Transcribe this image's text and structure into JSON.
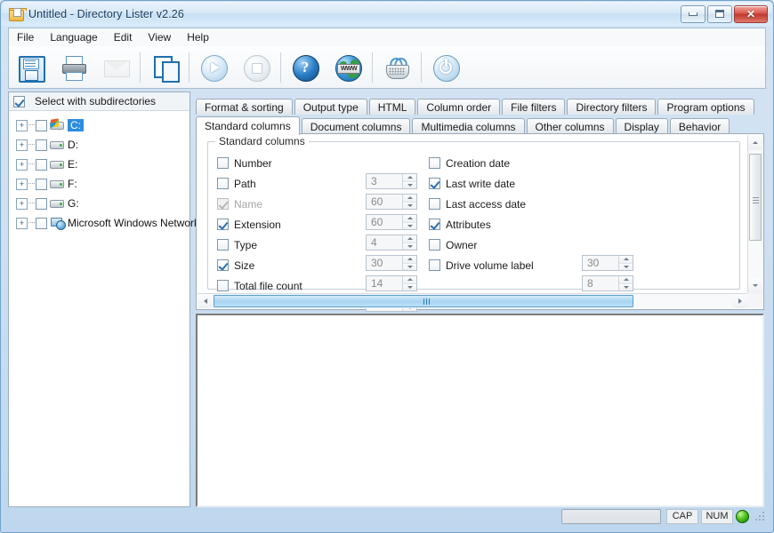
{
  "window": {
    "title": "Untitled - Directory Lister v2.26",
    "app_icon": "folder-document-icon",
    "controls": {
      "minimize": "minimize",
      "maximize": "maximize",
      "close": "close"
    }
  },
  "menubar": {
    "items": [
      {
        "label": "File"
      },
      {
        "label": "Language"
      },
      {
        "label": "Edit"
      },
      {
        "label": "View"
      },
      {
        "label": "Help"
      }
    ]
  },
  "toolbar": {
    "buttons": [
      {
        "name": "save-icon",
        "tooltip": "Save"
      },
      {
        "name": "print-icon",
        "tooltip": "Print"
      },
      {
        "name": "mail-icon",
        "tooltip": "Send by mail",
        "disabled": true
      },
      {
        "name": "copy-icon",
        "tooltip": "Copy"
      },
      {
        "name": "start-icon",
        "tooltip": "Start"
      },
      {
        "name": "stop-icon",
        "tooltip": "Stop",
        "disabled": true
      },
      {
        "name": "help-icon",
        "tooltip": "Help"
      },
      {
        "name": "www-icon",
        "tooltip": "Web site",
        "band_text": "WWW"
      },
      {
        "name": "basket-icon",
        "tooltip": "Buy"
      },
      {
        "name": "power-icon",
        "tooltip": "Exit"
      }
    ]
  },
  "tree": {
    "header_label": "Select with subdirectories",
    "header_checked": true,
    "items": [
      {
        "label": "C:",
        "icon": "windows-drive-icon",
        "selected": true,
        "checked": false,
        "expandable": true
      },
      {
        "label": "D:",
        "icon": "drive-icon",
        "selected": false,
        "checked": false,
        "expandable": true
      },
      {
        "label": "E:",
        "icon": "drive-icon",
        "selected": false,
        "checked": false,
        "expandable": true
      },
      {
        "label": "F:",
        "icon": "drive-icon",
        "selected": false,
        "checked": false,
        "expandable": true
      },
      {
        "label": "G:",
        "icon": "drive-icon",
        "selected": false,
        "checked": false,
        "expandable": true
      },
      {
        "label": "Microsoft Windows Network",
        "icon": "network-icon",
        "selected": false,
        "checked": false,
        "expandable": true
      }
    ],
    "expander_glyph": "+"
  },
  "tabs": {
    "row1": [
      {
        "label": "Format & sorting",
        "active": false
      },
      {
        "label": "Output type",
        "active": false
      },
      {
        "label": "HTML",
        "active": false
      },
      {
        "label": "Column order",
        "active": false
      },
      {
        "label": "File filters",
        "active": false
      },
      {
        "label": "Directory filters",
        "active": false
      },
      {
        "label": "Program options",
        "active": false
      }
    ],
    "row2": [
      {
        "label": "Standard columns",
        "active": true
      },
      {
        "label": "Document columns",
        "active": false
      },
      {
        "label": "Multimedia columns",
        "active": false
      },
      {
        "label": "Other columns",
        "active": false
      },
      {
        "label": "Display",
        "active": false
      },
      {
        "label": "Behavior",
        "active": false
      }
    ]
  },
  "panel": {
    "group_legend": "Standard columns",
    "left_options": [
      {
        "label": "Number",
        "checked": false,
        "disabled": false,
        "width": "3"
      },
      {
        "label": "Path",
        "checked": false,
        "disabled": false,
        "width": "60"
      },
      {
        "label": "Name",
        "checked": true,
        "disabled": true,
        "width": "60"
      },
      {
        "label": "Extension",
        "checked": true,
        "disabled": false,
        "width": "4"
      },
      {
        "label": "Type",
        "checked": false,
        "disabled": false,
        "width": "30"
      },
      {
        "label": "Size",
        "checked": true,
        "disabled": false,
        "width": "14"
      },
      {
        "label": "Total file count",
        "checked": false,
        "disabled": false,
        "width": "8"
      }
    ],
    "right_options": [
      {
        "label": "Creation date",
        "checked": false,
        "disabled": false,
        "width": null
      },
      {
        "label": "Last write date",
        "checked": true,
        "disabled": false,
        "width": null
      },
      {
        "label": "Last access date",
        "checked": false,
        "disabled": false,
        "width": null
      },
      {
        "label": "Attributes",
        "checked": true,
        "disabled": false,
        "width": null
      },
      {
        "label": "Owner",
        "checked": false,
        "disabled": false,
        "width": "30"
      },
      {
        "label": "Drive volume label",
        "checked": false,
        "disabled": false,
        "width": "8"
      }
    ]
  },
  "statusbar": {
    "cap_label": "CAP",
    "num_label": "NUM",
    "indicator_color": "#4fc21e"
  },
  "colors": {
    "accent": "#2d8ce0",
    "window_frame": "#6fa2c8",
    "title_text": "#123a5e",
    "close_button": "#c0372d"
  }
}
